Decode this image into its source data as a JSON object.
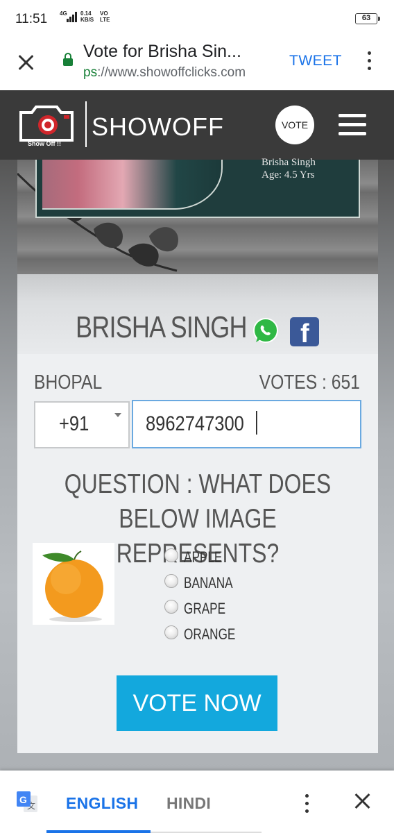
{
  "status_bar": {
    "time": "11:51",
    "network_type": "4G",
    "speed_value": "0.14",
    "speed_unit": "KB/S",
    "volte": "VO",
    "lte": "LTE",
    "battery": "63"
  },
  "browser": {
    "page_title": "Vote for Brisha Sin...",
    "url_scheme": "ps",
    "url_rest": "://www.showoffclicks.com",
    "tweet_label": "TWEET"
  },
  "site_header": {
    "logo_caption": "Show Off !!",
    "brand": "SHOWOFF",
    "vote_label": "VOTE"
  },
  "photo": {
    "name": "Brisha Singh",
    "age": "Age: 4.5  Yrs"
  },
  "card": {
    "contestant_name": "BRISHA SINGH",
    "city": "BHOPAL",
    "votes_label": "VOTES : 651",
    "country_code": "+91",
    "phone_value": "8962747300",
    "question": "QUESTION : WHAT DOES BELOW IMAGE REPRESENTS?",
    "options": [
      {
        "label": "APPLE"
      },
      {
        "label": "BANANA"
      },
      {
        "label": "GRAPE"
      },
      {
        "label": "ORANGE"
      }
    ],
    "vote_now_label": "VOTE NOW"
  },
  "translate_bar": {
    "lang_1": "ENGLISH",
    "lang_2": "HINDI"
  },
  "colors": {
    "vote_button": "#13a8dd",
    "header_bg": "#3a3a3a",
    "link_blue": "#1a73e8",
    "secure_green": "#188038"
  },
  "icons": [
    "close-icon",
    "lock-icon",
    "more-icon",
    "camera-logo-icon",
    "menu-icon",
    "whatsapp-icon",
    "facebook-icon",
    "dropdown-caret-icon",
    "orange-fruit-image",
    "google-translate-icon"
  ]
}
